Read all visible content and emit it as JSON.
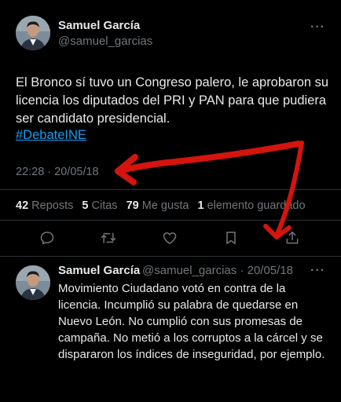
{
  "main_tweet": {
    "author_name": "Samuel García",
    "author_handle": "@samuel_garcias",
    "text": "El Bronco sí tuvo un Congreso palero, le aprobaron su licencia los diputados del PRI y PAN para que pudiera ser candidato presidencial.",
    "hashtag": "#DebateINE",
    "timestamp": "22:28 · 20/05/18",
    "stats": {
      "reposts_count": "42",
      "reposts_label": "Reposts",
      "quotes_count": "5",
      "quotes_label": "Citas",
      "likes_count": "79",
      "likes_label": "Me gusta",
      "bookmarks_count": "1",
      "bookmarks_label": "elemento guardado"
    },
    "actions": [
      "reply-icon",
      "repost-icon",
      "like-icon",
      "bookmark-icon",
      "share-icon"
    ]
  },
  "reply_tweet": {
    "author_name": "Samuel García",
    "author_handle_date": "@samuel_garcias · 20/05/18",
    "text": "Movimiento Ciudadano votó en contra de la licencia. Incumplió su palabra de quedarse en Nuevo León. No cumplió con sus promesas de campaña. No metió a los corruptos a la cárcel y se dispararon los índices de inseguridad, por ejemplo."
  },
  "more_icon": "···",
  "colors": {
    "background": "#000000",
    "text": "#e7e9ea",
    "secondary": "#71767b",
    "link": "#1d9bf0",
    "divider": "#2f3336",
    "annotation_red": "#d4140f"
  }
}
